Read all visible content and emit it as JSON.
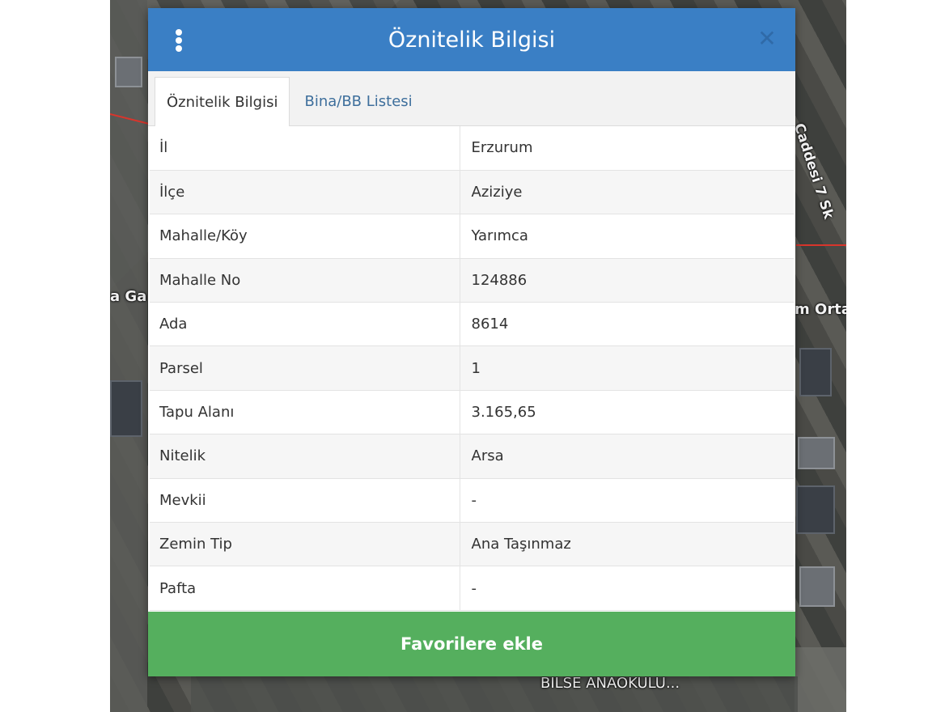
{
  "map": {
    "labels": [
      "Caddesi 7 Sk",
      "a Ga",
      "m Orta",
      "BILSE ANAOKULU..."
    ],
    "road_line_color": "#d8352c"
  },
  "dialog": {
    "title": "Öznitelik Bilgisi",
    "menu_icon": "kebab-menu-icon",
    "close_icon": "close-icon",
    "header_color": "#3a7fc5",
    "tabs": [
      {
        "label": "Öznitelik Bilgisi",
        "active": true
      },
      {
        "label": "Bina/BB Listesi",
        "active": false
      }
    ],
    "rows": [
      {
        "key": "İl",
        "value": "Erzurum"
      },
      {
        "key": "İlçe",
        "value": "Aziziye"
      },
      {
        "key": "Mahalle/Köy",
        "value": "Yarımca"
      },
      {
        "key": "Mahalle No",
        "value": "124886"
      },
      {
        "key": "Ada",
        "value": "8614"
      },
      {
        "key": "Parsel",
        "value": "1"
      },
      {
        "key": "Tapu Alanı",
        "value": "3.165,65"
      },
      {
        "key": "Nitelik",
        "value": "Arsa"
      },
      {
        "key": "Mevkii",
        "value": "-"
      },
      {
        "key": "Zemin Tip",
        "value": "Ana Taşınmaz"
      },
      {
        "key": "Pafta",
        "value": "-"
      }
    ],
    "favorite_button": "Favorilere ekle",
    "favorite_color": "#55af5e"
  }
}
